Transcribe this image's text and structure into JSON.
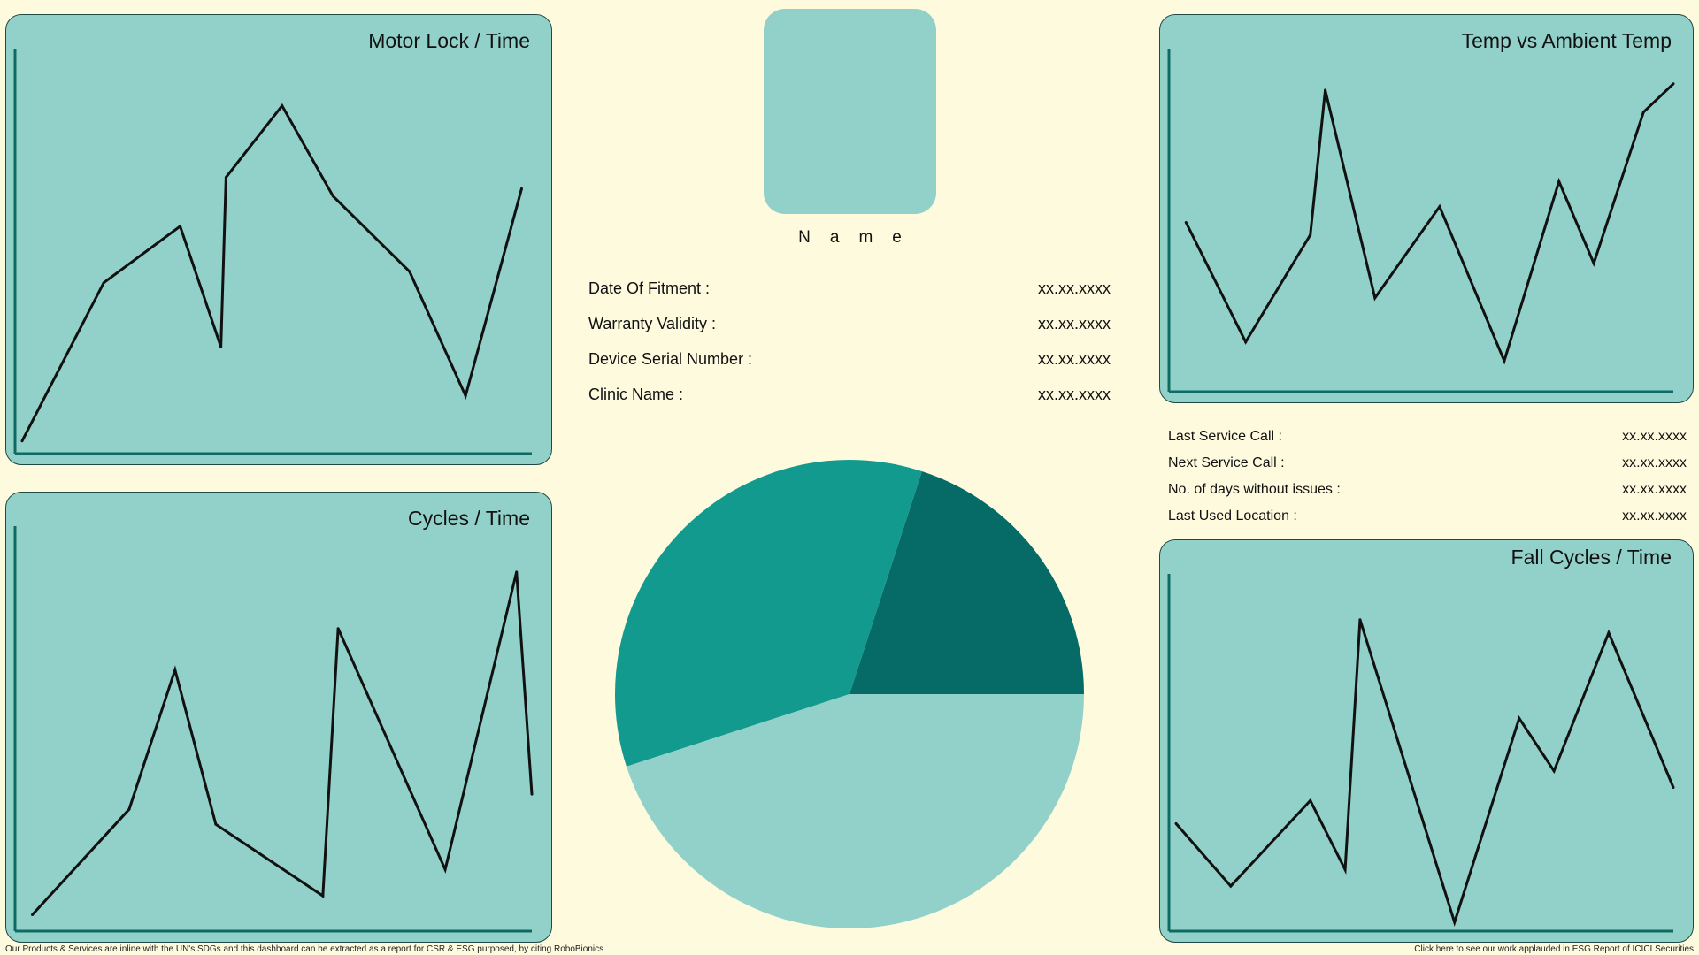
{
  "colors": {
    "background": "#fefade",
    "card": "#92d1c9",
    "card_border": "#1d4a45",
    "axis": "#0e6b63",
    "line": "#111111",
    "pie": [
      "#066a66",
      "#139a8f",
      "#92d1c9"
    ]
  },
  "profile": {
    "avatar_icon": "user-avatar-placeholder",
    "name": "Name"
  },
  "device_info": [
    {
      "label": "Date Of Fitment :",
      "value": "xx.xx.xxxx"
    },
    {
      "label": "Warranty Validity :",
      "value": "xx.xx.xxxx"
    },
    {
      "label": "Device Serial Number :",
      "value": "xx.xx.xxxx"
    },
    {
      "label": "Clinic Name :",
      "value": "xx.xx.xxxx"
    }
  ],
  "service_info": [
    {
      "label": "Last Service Call :",
      "value": "xx.xx.xxxx"
    },
    {
      "label": "Next Service Call :",
      "value": "xx.xx.xxxx"
    },
    {
      "label": "No. of days without issues :",
      "value": "xx.xx.xxxx"
    },
    {
      "label": "Last Used Location :",
      "value": "xx.xx.xxxx"
    }
  ],
  "chart_data": [
    {
      "type": "line",
      "title": "Motor Lock / Time",
      "series": [
        {
          "values": [
            1,
            43,
            58,
            26,
            71,
            90,
            66,
            46,
            13,
            68
          ]
        }
      ],
      "x": [
        0,
        16,
        31,
        39,
        40,
        51,
        61,
        76,
        87,
        98
      ],
      "xlim": [
        0,
        100
      ],
      "ylim": [
        0,
        100
      ],
      "grid": false
    },
    {
      "type": "line",
      "title": "Temp vs Ambient Temp",
      "series": [
        {
          "values": [
            51,
            13,
            47,
            93,
            27,
            56,
            7,
            64,
            38,
            86,
            95
          ]
        }
      ],
      "x": [
        2,
        14,
        27,
        30,
        40,
        53,
        66,
        77,
        84,
        94,
        100
      ],
      "xlim": [
        0,
        100
      ],
      "ylim": [
        0,
        100
      ],
      "grid": false
    },
    {
      "type": "line",
      "title": "Cycles / Time",
      "series": [
        {
          "values": [
            2,
            30,
            67,
            26,
            7,
            78,
            14,
            93,
            34
          ]
        }
      ],
      "x": [
        2,
        21,
        30,
        38,
        59,
        62,
        83,
        97,
        100
      ],
      "xlim": [
        0,
        100
      ],
      "ylim": [
        0,
        100
      ],
      "grid": false
    },
    {
      "type": "line",
      "title": "Fall Cycles / Time",
      "series": [
        {
          "values": [
            30,
            11,
            37,
            16,
            92,
            0,
            62,
            46,
            88,
            41
          ]
        }
      ],
      "x": [
        0,
        11,
        27,
        34,
        37,
        56,
        69,
        76,
        87,
        100
      ],
      "xlim": [
        0,
        100
      ],
      "ylim": [
        0,
        100
      ],
      "grid": false
    },
    {
      "type": "pie",
      "values": [
        20,
        35,
        45
      ],
      "colors": [
        "#066a66",
        "#139a8f",
        "#92d1c9"
      ]
    }
  ],
  "footer": {
    "left": "Our Products & Services are inline with the UN's SDGs and this dashboard can be extracted as a report for CSR & ESG purposed, by citing RoboBionics",
    "right": "Click here to see our work applauded in ESG Report of ICICI Securities"
  }
}
